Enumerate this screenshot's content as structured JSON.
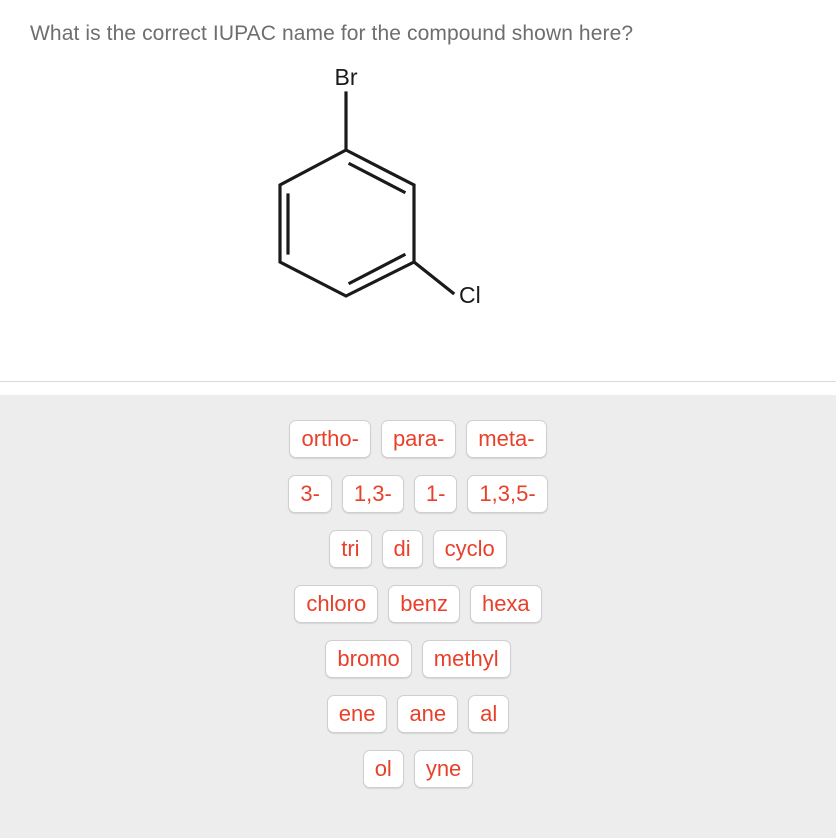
{
  "question": {
    "text": "What is the correct IUPAC name for the compound shown here?"
  },
  "structure": {
    "name": "benzene-ring-structure",
    "substituents": [
      {
        "label": "Br",
        "position": "top"
      },
      {
        "label": "Cl",
        "position": "lower-right"
      }
    ],
    "bond_color": "#1a1a1a",
    "label_color": "#1a1a1a"
  },
  "answer_bank": {
    "accent_color": "#e8412b",
    "tile_background": "#ffffff",
    "panel_background": "#ededed",
    "rows": [
      {
        "tiles": [
          "ortho-",
          "para-",
          "meta-"
        ]
      },
      {
        "tiles": [
          "3-",
          "1,3-",
          "1-",
          "1,3,5-"
        ]
      },
      {
        "tiles": [
          "tri",
          "di",
          "cyclo"
        ]
      },
      {
        "tiles": [
          "chloro",
          "benz",
          "hexa"
        ]
      },
      {
        "tiles": [
          "bromo",
          "methyl"
        ]
      },
      {
        "tiles": [
          "ene",
          "ane",
          "al"
        ]
      },
      {
        "tiles": [
          "ol",
          "yne"
        ]
      }
    ]
  }
}
